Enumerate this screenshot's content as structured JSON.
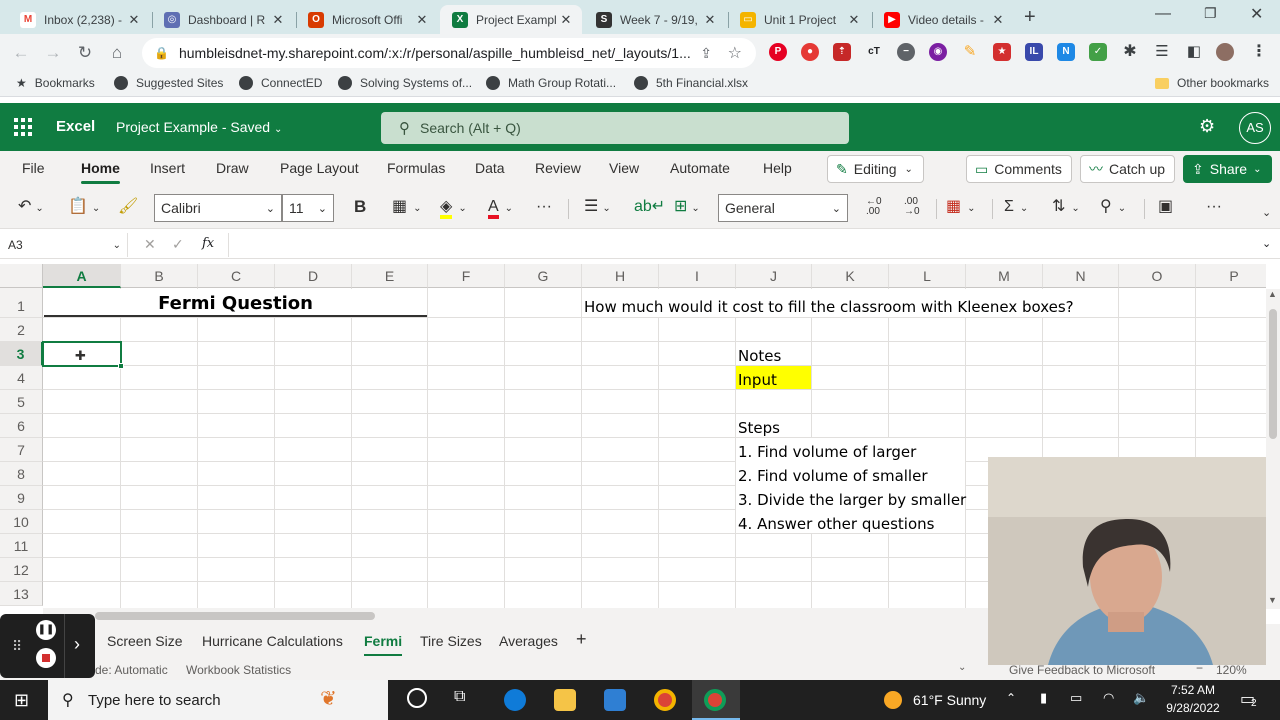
{
  "browser": {
    "tabs": [
      {
        "title": "Inbox (2,238) -",
        "favicon": "gmail-icon",
        "color": "#ea4335",
        "glyph": "M",
        "active": false
      },
      {
        "title": "Dashboard | R",
        "favicon": "dashboard-icon",
        "color": "#5f6fb3",
        "glyph": "◎",
        "active": false
      },
      {
        "title": "Microsoft Offi",
        "favicon": "office-icon",
        "color": "#d83b01",
        "glyph": "O",
        "active": false
      },
      {
        "title": "Project Exampl",
        "favicon": "excel-icon",
        "color": "#107c41",
        "glyph": "X",
        "active": true
      },
      {
        "title": "Week 7 - 9/19,",
        "favicon": "schoology-icon",
        "color": "#333333",
        "glyph": "S",
        "active": false
      },
      {
        "title": "Unit 1 Project",
        "favicon": "slides-icon",
        "color": "#f4b400",
        "glyph": "▭",
        "active": false
      },
      {
        "title": "Video details -",
        "favicon": "youtube-icon",
        "color": "#ff0000",
        "glyph": "▶",
        "active": false
      }
    ],
    "new_tab": "+",
    "url": "humbleisdnet-my.sharepoint.com/:x:/r/personal/aspille_humbleisd_net/_layouts/1...",
    "bookmarks": [
      "Bookmarks",
      "Suggested Sites",
      "ConnectED",
      "Solving Systems of...",
      "Math Group Rotati...",
      "5th Financial.xlsx"
    ],
    "other_bookmarks": "Other bookmarks"
  },
  "excel": {
    "app_name": "Excel",
    "doc_title": "Project Example - Saved",
    "search_placeholder": "Search (Alt + Q)",
    "avatar_initials": "AS",
    "ribbon_tabs": [
      "File",
      "Home",
      "Insert",
      "Draw",
      "Page Layout",
      "Formulas",
      "Data",
      "Review",
      "View",
      "Automate",
      "Help"
    ],
    "active_ribbon_tab": "Home",
    "editing_label": "Editing",
    "comments_label": "Comments",
    "catchup_label": "Catch up",
    "share_label": "Share",
    "font_name": "Calibri",
    "font_size": "11",
    "bold_label": "B",
    "number_format": "General",
    "increase_decimal": "←0 .00",
    "decrease_decimal": ".00 →0",
    "name_box": "A3",
    "fx_label": "fx",
    "formula": ""
  },
  "sheet": {
    "columns": [
      "A",
      "B",
      "C",
      "D",
      "E",
      "F",
      "G",
      "H",
      "I",
      "J",
      "K",
      "L",
      "M",
      "N",
      "O",
      "P"
    ],
    "rows": [
      "1",
      "2",
      "3",
      "4",
      "5",
      "6",
      "7",
      "8",
      "9",
      "10",
      "11",
      "12",
      "13"
    ],
    "selected_cell": "A3",
    "title_cell": "Fermi Question",
    "question": "How much would it cost to fill the classroom with Kleenex boxes?",
    "notes_label": "Notes",
    "input_label": "Input",
    "input_color": "#ffff00",
    "steps_label": "Steps",
    "steps": [
      "1. Find volume of larger",
      "2. Find volume of smaller",
      "3. Divide the larger by smaller",
      "4. Answer other questions"
    ]
  },
  "sheet_tabs": [
    "Screen Size",
    "Hurricane Calculations",
    "Fermi",
    "Tire Sizes",
    "Averages"
  ],
  "active_sheet": "Fermi",
  "status": {
    "calc_mode": "de: Automatic",
    "workbook_stats": "Workbook Statistics",
    "feedback": "Give Feedback to Microsoft",
    "zoom": "120%"
  },
  "taskbar": {
    "search_placeholder": "Type here to search",
    "weather": "61°F  Sunny",
    "time": "7:52 AM",
    "date": "9/28/2022",
    "notification_count": "2"
  }
}
